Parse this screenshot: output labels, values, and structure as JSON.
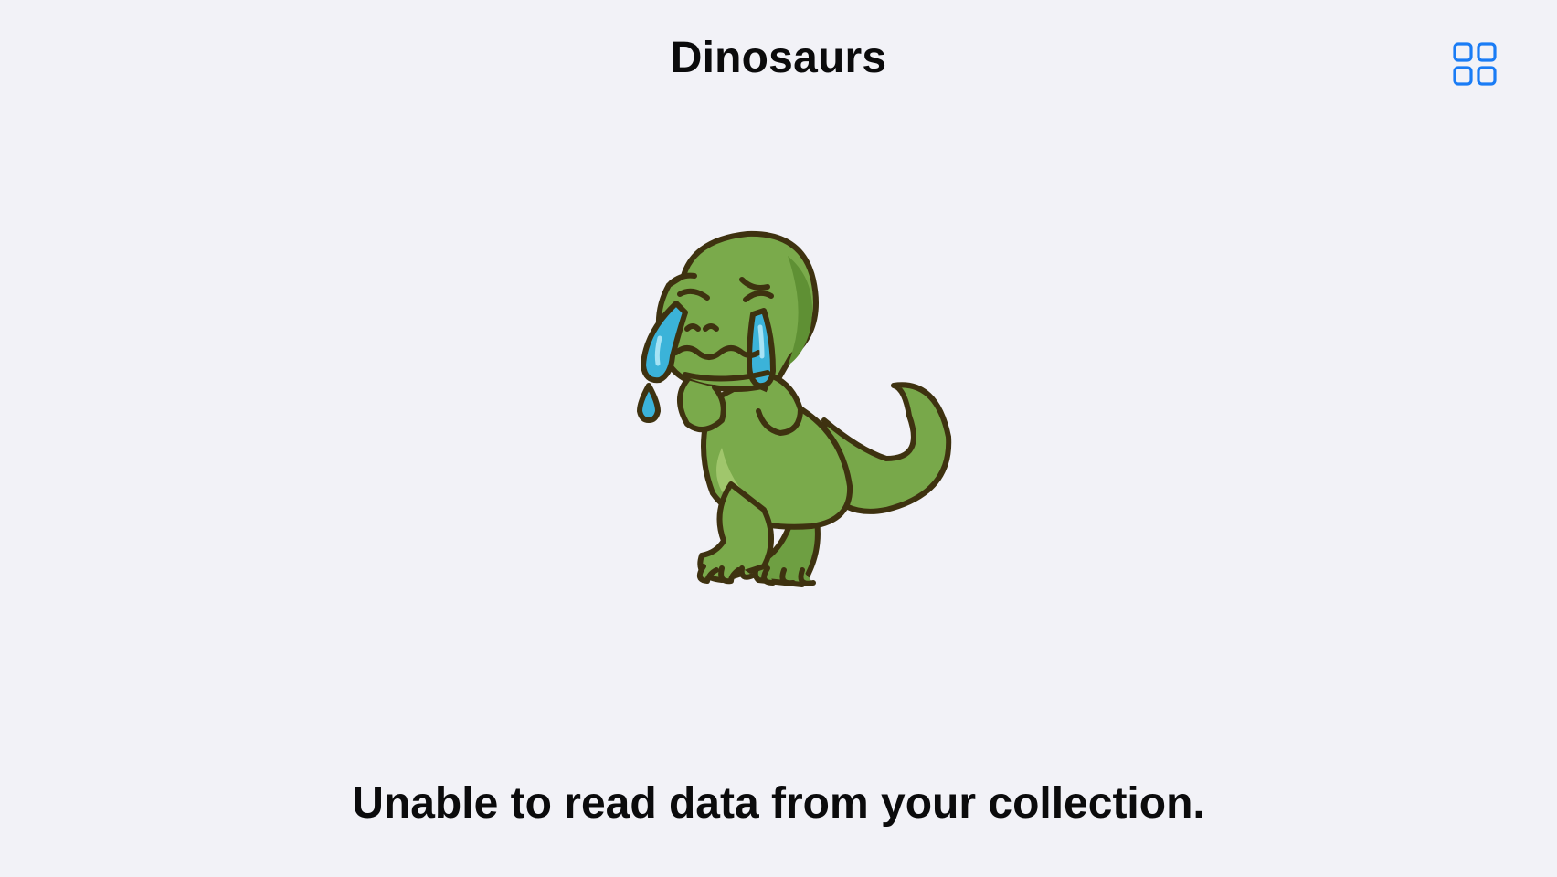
{
  "nav": {
    "title": "Dinosaurs",
    "layout_button_icon": "grid-icon",
    "accent_color": "#1a7cf5"
  },
  "empty_state": {
    "illustration": "crying-dinosaur-illustration",
    "message": "Unable to read data from your collection."
  }
}
